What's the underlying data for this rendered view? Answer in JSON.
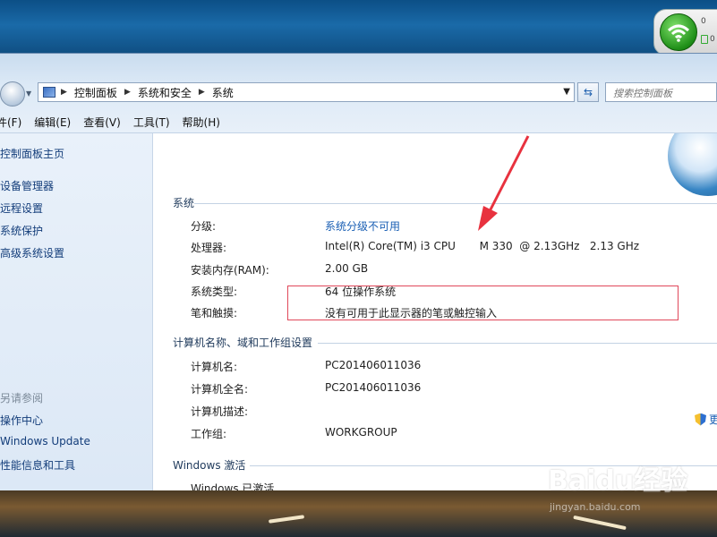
{
  "network_gadget": {
    "upload_text": "0",
    "download_text": "0"
  },
  "address": {
    "crumbs": [
      "控制面板",
      "系统和安全",
      "系统"
    ],
    "search_placeholder": "搜索控制面板"
  },
  "menu": [
    "件(F)",
    "编辑(E)",
    "查看(V)",
    "工具(T)",
    "帮助(H)"
  ],
  "nav": {
    "home": "控制面板主页",
    "links": [
      "设备管理器",
      "远程设置",
      "系统保护",
      "高级系统设置"
    ],
    "see_also_header": "另请参阅",
    "see_also": [
      "操作中心",
      "Windows Update",
      "性能信息和工具"
    ]
  },
  "system": {
    "title": "系统",
    "rating_label": "分级:",
    "rating_value": "系统分级不可用",
    "cpu_label": "处理器:",
    "cpu_value": "Intel(R) Core(TM) i3 CPU       M 330  @ 2.13GHz   2.13 GHz",
    "ram_label": "安装内存(RAM):",
    "ram_value": "2.00 GB",
    "type_label": "系统类型:",
    "type_value": "64 位操作系统",
    "pen_label": "笔和触摸:",
    "pen_value": "没有可用于此显示器的笔或触控输入"
  },
  "computer": {
    "title": "计算机名称、域和工作组设置",
    "name_label": "计算机名:",
    "name_value": "PC201406011036",
    "fullname_label": "计算机全名:",
    "fullname_value": "PC201406011036",
    "desc_label": "计算机描述:",
    "workgroup_label": "工作组:",
    "workgroup_value": "WORKGROUP",
    "change_link": "更"
  },
  "activation": {
    "title": "Windows 激活",
    "status": "Windows 已激活"
  },
  "watermark": {
    "main": "Baidu经验",
    "sub": "jingyan.baidu.com"
  },
  "colors": {
    "highlight": "#e0485a",
    "link": "#1a5fb4",
    "arrow": "#e8323f"
  }
}
